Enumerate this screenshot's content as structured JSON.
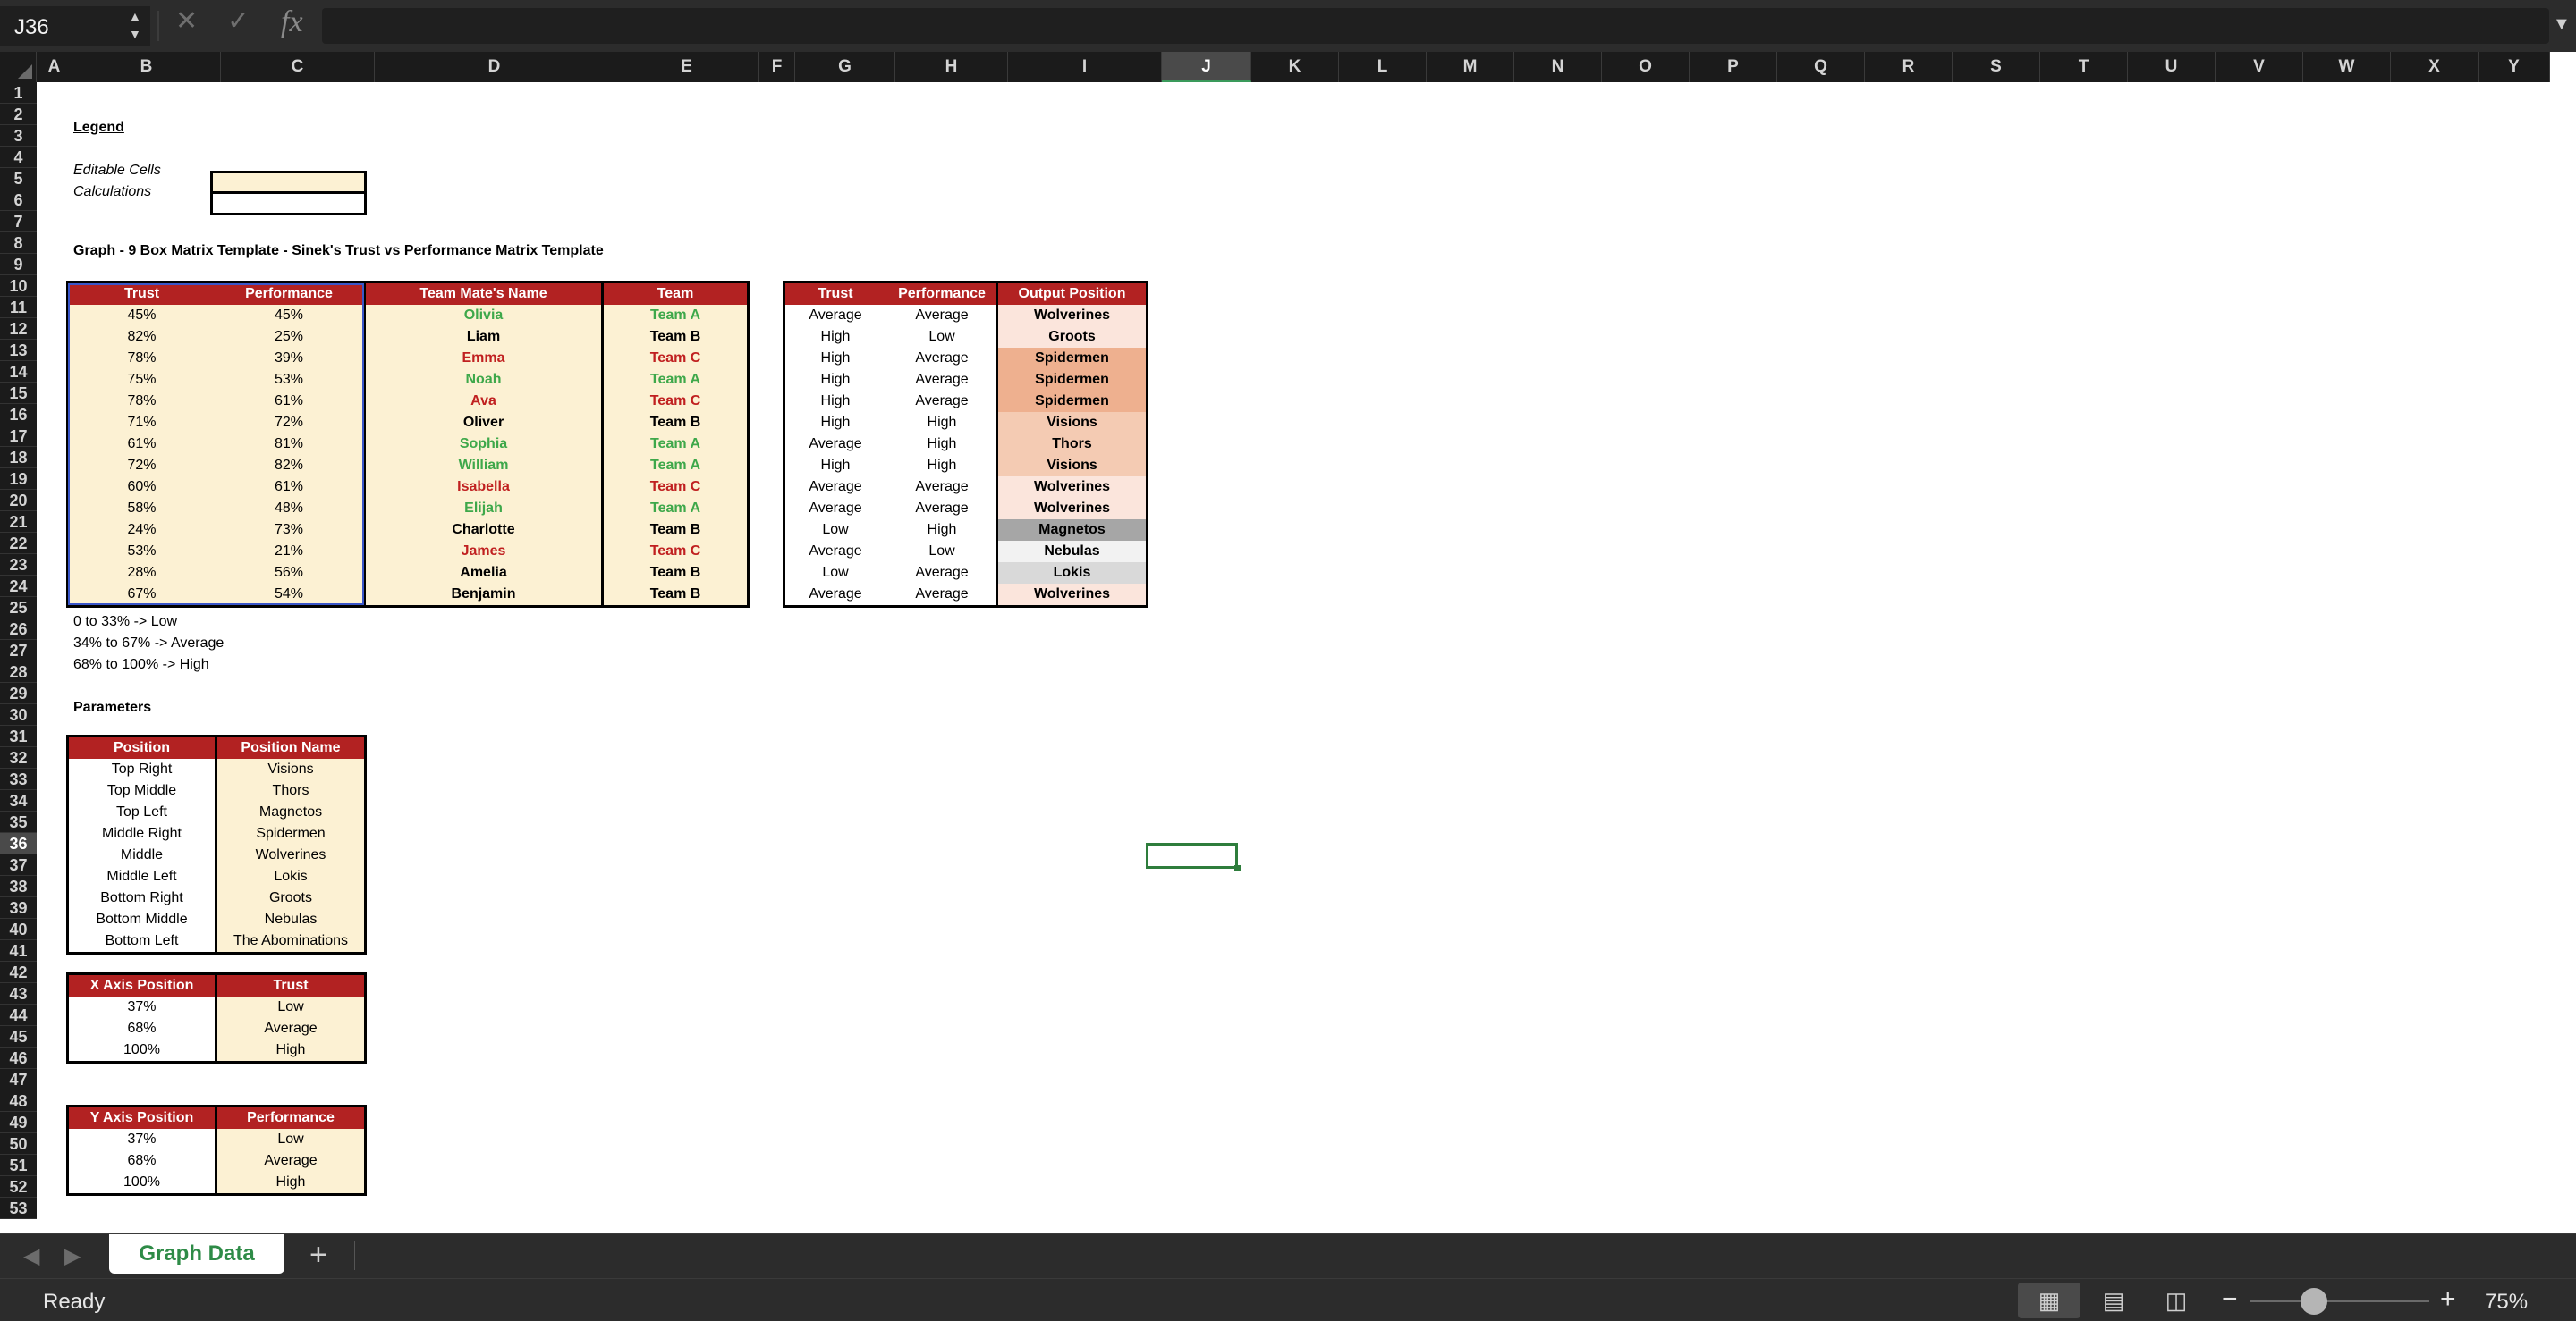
{
  "formula_bar": {
    "name_box": "J36",
    "fx": "fx",
    "formula": ""
  },
  "columns": [
    "A",
    "B",
    "C",
    "D",
    "E",
    "F",
    "G",
    "H",
    "I",
    "J",
    "K",
    "L",
    "M",
    "N",
    "O",
    "P",
    "Q",
    "R",
    "S",
    "T",
    "U",
    "V",
    "W",
    "X",
    "Y"
  ],
  "selected_column": "J",
  "selected_row": "36",
  "rows": [
    "1",
    "2",
    "3",
    "4",
    "5",
    "6",
    "7",
    "8",
    "9",
    "10",
    "11",
    "12",
    "13",
    "14",
    "15",
    "16",
    "17",
    "18",
    "19",
    "20",
    "21",
    "22",
    "23",
    "24",
    "25",
    "26",
    "27",
    "28",
    "29",
    "30",
    "31",
    "32",
    "33",
    "34",
    "35",
    "36",
    "37",
    "38",
    "39",
    "40",
    "41",
    "42",
    "43",
    "44",
    "45",
    "46",
    "47",
    "48",
    "49",
    "50",
    "51",
    "52",
    "53"
  ],
  "legend": {
    "title": "Legend",
    "editable_label": "Editable Cells",
    "calc_label": "Calculations"
  },
  "graph_title": "Graph - 9 Box Matrix Template - Sinek's Trust vs Performance Matrix Template",
  "input_table": {
    "headers": [
      "Trust",
      "Performance",
      "Team Mate's Name",
      "Team"
    ],
    "rows": [
      {
        "trust": "45%",
        "perf": "45%",
        "name": "Olivia",
        "team": "Team A",
        "color": "green"
      },
      {
        "trust": "82%",
        "perf": "25%",
        "name": "Liam",
        "team": "Team B",
        "color": "black"
      },
      {
        "trust": "78%",
        "perf": "39%",
        "name": "Emma",
        "team": "Team C",
        "color": "red"
      },
      {
        "trust": "75%",
        "perf": "53%",
        "name": "Noah",
        "team": "Team A",
        "color": "green"
      },
      {
        "trust": "78%",
        "perf": "61%",
        "name": "Ava",
        "team": "Team C",
        "color": "red"
      },
      {
        "trust": "71%",
        "perf": "72%",
        "name": "Oliver",
        "team": "Team B",
        "color": "black"
      },
      {
        "trust": "61%",
        "perf": "81%",
        "name": "Sophia",
        "team": "Team A",
        "color": "green"
      },
      {
        "trust": "72%",
        "perf": "82%",
        "name": "William",
        "team": "Team A",
        "color": "green"
      },
      {
        "trust": "60%",
        "perf": "61%",
        "name": "Isabella",
        "team": "Team C",
        "color": "red"
      },
      {
        "trust": "58%",
        "perf": "48%",
        "name": "Elijah",
        "team": "Team A",
        "color": "green"
      },
      {
        "trust": "24%",
        "perf": "73%",
        "name": "Charlotte",
        "team": "Team B",
        "color": "black"
      },
      {
        "trust": "53%",
        "perf": "21%",
        "name": "James",
        "team": "Team C",
        "color": "red"
      },
      {
        "trust": "28%",
        "perf": "56%",
        "name": "Amelia",
        "team": "Team B",
        "color": "black"
      },
      {
        "trust": "67%",
        "perf": "54%",
        "name": "Benjamin",
        "team": "Team B",
        "color": "black"
      }
    ]
  },
  "output_table": {
    "headers": [
      "Trust",
      "Performance",
      "Output Position"
    ],
    "rows": [
      {
        "trust": "Average",
        "perf": "Average",
        "pos": "Wolverines",
        "bg": "#fbe5dc"
      },
      {
        "trust": "High",
        "perf": "Low",
        "pos": "Groots",
        "bg": "#fbe5dc"
      },
      {
        "trust": "High",
        "perf": "Average",
        "pos": "Spidermen",
        "bg": "#eeb08f"
      },
      {
        "trust": "High",
        "perf": "Average",
        "pos": "Spidermen",
        "bg": "#eeb08f"
      },
      {
        "trust": "High",
        "perf": "Average",
        "pos": "Spidermen",
        "bg": "#eeb08f"
      },
      {
        "trust": "High",
        "perf": "High",
        "pos": "Visions",
        "bg": "#f4cbb3"
      },
      {
        "trust": "Average",
        "perf": "High",
        "pos": "Thors",
        "bg": "#f4cbb3"
      },
      {
        "trust": "High",
        "perf": "High",
        "pos": "Visions",
        "bg": "#f4cbb3"
      },
      {
        "trust": "Average",
        "perf": "Average",
        "pos": "Wolverines",
        "bg": "#fbe5dc"
      },
      {
        "trust": "Average",
        "perf": "Average",
        "pos": "Wolverines",
        "bg": "#fbe5dc"
      },
      {
        "trust": "Low",
        "perf": "High",
        "pos": "Magnetos",
        "bg": "#a6a6a6"
      },
      {
        "trust": "Average",
        "perf": "Low",
        "pos": "Nebulas",
        "bg": "#f2f2f2"
      },
      {
        "trust": "Low",
        "perf": "Average",
        "pos": "Lokis",
        "bg": "#d9d9d9"
      },
      {
        "trust": "Average",
        "perf": "Average",
        "pos": "Wolverines",
        "bg": "#fbe5dc"
      }
    ]
  },
  "ranges": [
    "0 to 33% -> Low",
    "34% to 67% -> Average",
    "68% to 100% -> High"
  ],
  "parameters_title": "Parameters",
  "position_table": {
    "headers": [
      "Position",
      "Position Name"
    ],
    "rows": [
      [
        "Top Right",
        "Visions"
      ],
      [
        "Top Middle",
        "Thors"
      ],
      [
        "Top Left",
        "Magnetos"
      ],
      [
        "Middle Right",
        "Spidermen"
      ],
      [
        "Middle",
        "Wolverines"
      ],
      [
        "Middle Left",
        "Lokis"
      ],
      [
        "Bottom Right",
        "Groots"
      ],
      [
        "Bottom Middle",
        "Nebulas"
      ],
      [
        "Bottom Left",
        "The Abominations"
      ]
    ]
  },
  "x_axis_table": {
    "headers": [
      "X Axis Position",
      "Trust"
    ],
    "rows": [
      [
        "37%",
        "Low"
      ],
      [
        "68%",
        "Average"
      ],
      [
        "100%",
        "High"
      ]
    ]
  },
  "y_axis_table": {
    "headers": [
      "Y Axis Position",
      "Performance"
    ],
    "rows": [
      [
        "37%",
        "Low"
      ],
      [
        "68%",
        "Average"
      ],
      [
        "100%",
        "High"
      ]
    ]
  },
  "tabs": {
    "active": "Graph Data",
    "add": "+"
  },
  "status": {
    "text": "Ready",
    "zoom": "75%",
    "minus": "−",
    "plus": "+"
  },
  "colors": {
    "header_red": "#b22222",
    "cream": "#fcf1d3",
    "team_green": "#3ea84a",
    "team_red": "#c02020",
    "accent": "#2e7d3c"
  }
}
